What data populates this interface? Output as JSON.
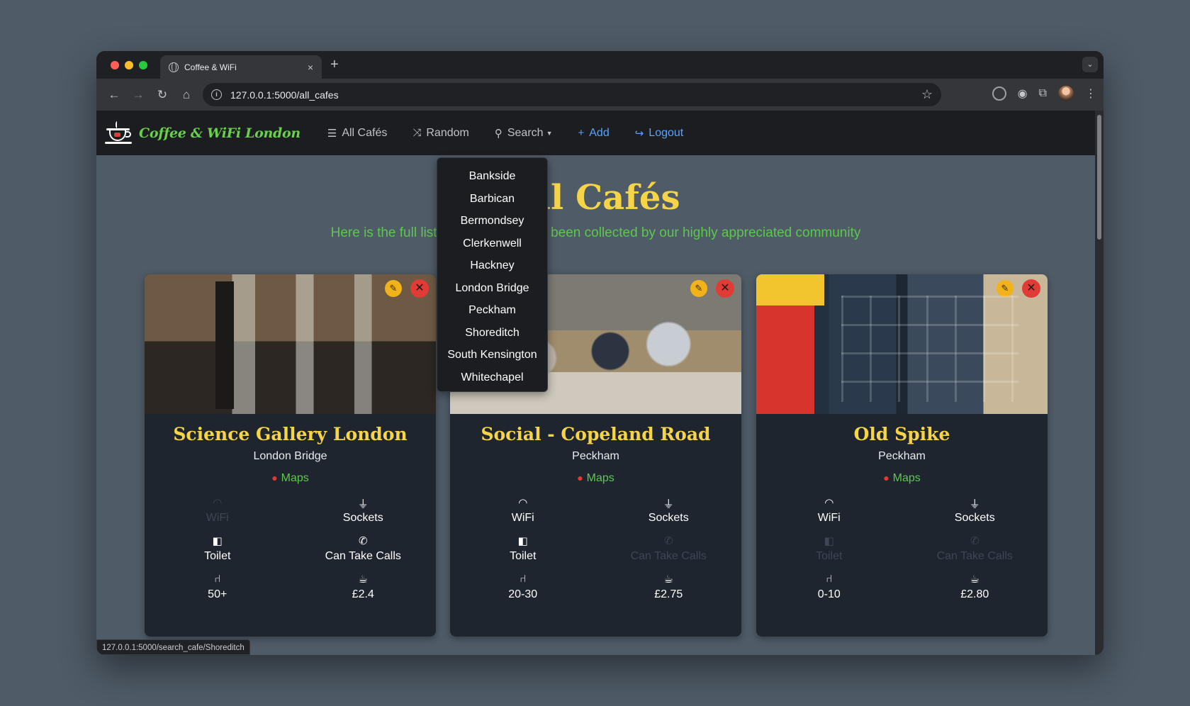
{
  "browser": {
    "tab_title": "Coffee & WiFi",
    "tab_close": "×",
    "new_tab": "+",
    "tab_menu": "⌄",
    "url": "127.0.0.1:5000/all_cafes",
    "status_url": "127.0.0.1:5000/search_cafe/Shoreditch"
  },
  "navbar": {
    "brand": "Coffee & WiFi London",
    "links": {
      "all": "All Cafés",
      "random": "Random",
      "search": "Search",
      "add": "Add",
      "logout": "Logout"
    }
  },
  "page": {
    "heading": "All Cafés",
    "subtitle": "Here is the full list of cafés that have been collected by our highly appreciated community"
  },
  "search_menu": [
    "Bankside",
    "Barbican",
    "Bermondsey",
    "Clerkenwell",
    "Hackney",
    "London Bridge",
    "Peckham",
    "Shoreditch",
    "South Kensington",
    "Whitechapel"
  ],
  "amenity_labels": {
    "wifi": "WiFi",
    "sockets": "Sockets",
    "toilet": "Toilet",
    "calls": "Can Take Calls"
  },
  "cafes": [
    {
      "name": "Science Gallery London",
      "location": "London Bridge",
      "maps": "Maps",
      "seats": "50+",
      "coffee_price": "£2.4",
      "has_wifi": false,
      "has_sockets": true,
      "has_toilet": true,
      "can_take_calls": true
    },
    {
      "name": "Social - Copeland Road",
      "location": "Peckham",
      "maps": "Maps",
      "seats": "20-30",
      "coffee_price": "£2.75",
      "has_wifi": true,
      "has_sockets": true,
      "has_toilet": true,
      "can_take_calls": false
    },
    {
      "name": "Old Spike",
      "location": "Peckham",
      "maps": "Maps",
      "seats": "0-10",
      "coffee_price": "£2.80",
      "has_wifi": true,
      "has_sockets": true,
      "has_toilet": false,
      "can_take_calls": false
    }
  ],
  "colors": {
    "brand_green": "#6ad04b",
    "heading_yellow": "#f5d547",
    "link_blue": "#58a3ff",
    "delete_red": "#e13b35",
    "edit_yellow": "#f2b31a"
  }
}
